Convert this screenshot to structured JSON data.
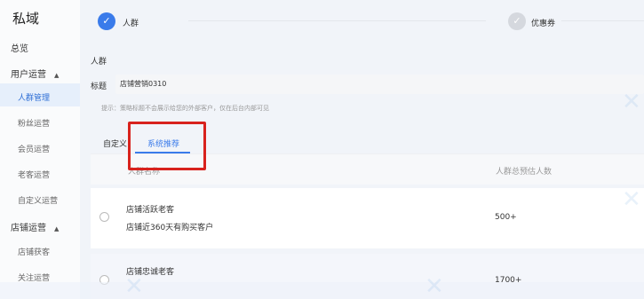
{
  "sidebar": {
    "brand": "私域",
    "overview": "总览",
    "group_user": "用户运营",
    "user_items": [
      "人群管理",
      "粉丝运营",
      "会员运营",
      "老客运营",
      "自定义运营"
    ],
    "group_store": "店铺运营",
    "store_items": [
      "店铺获客",
      "关注运营"
    ]
  },
  "stepper": {
    "step1_label": "人群",
    "step2_label": "优惠券",
    "check_glyph": "✓"
  },
  "form": {
    "section_title": "人群",
    "title_label": "标题",
    "title_value": "店铺营销0310",
    "hint": "提示：策略标题不会展示给您的外部客户，仅在后台内部可见"
  },
  "tabs": {
    "custom": "自定义",
    "system": "系统推荐"
  },
  "table": {
    "headers": [
      "人群名称",
      "人群总预估人数"
    ],
    "rows": [
      {
        "title": "店铺活跃老客",
        "desc": "店铺近360天有购买客户",
        "count": "500+"
      },
      {
        "title": "店铺忠诚老客",
        "desc": "",
        "count": "1700+"
      }
    ]
  },
  "colors": {
    "accent": "#3a7bea",
    "highlight": "#d8221d"
  }
}
